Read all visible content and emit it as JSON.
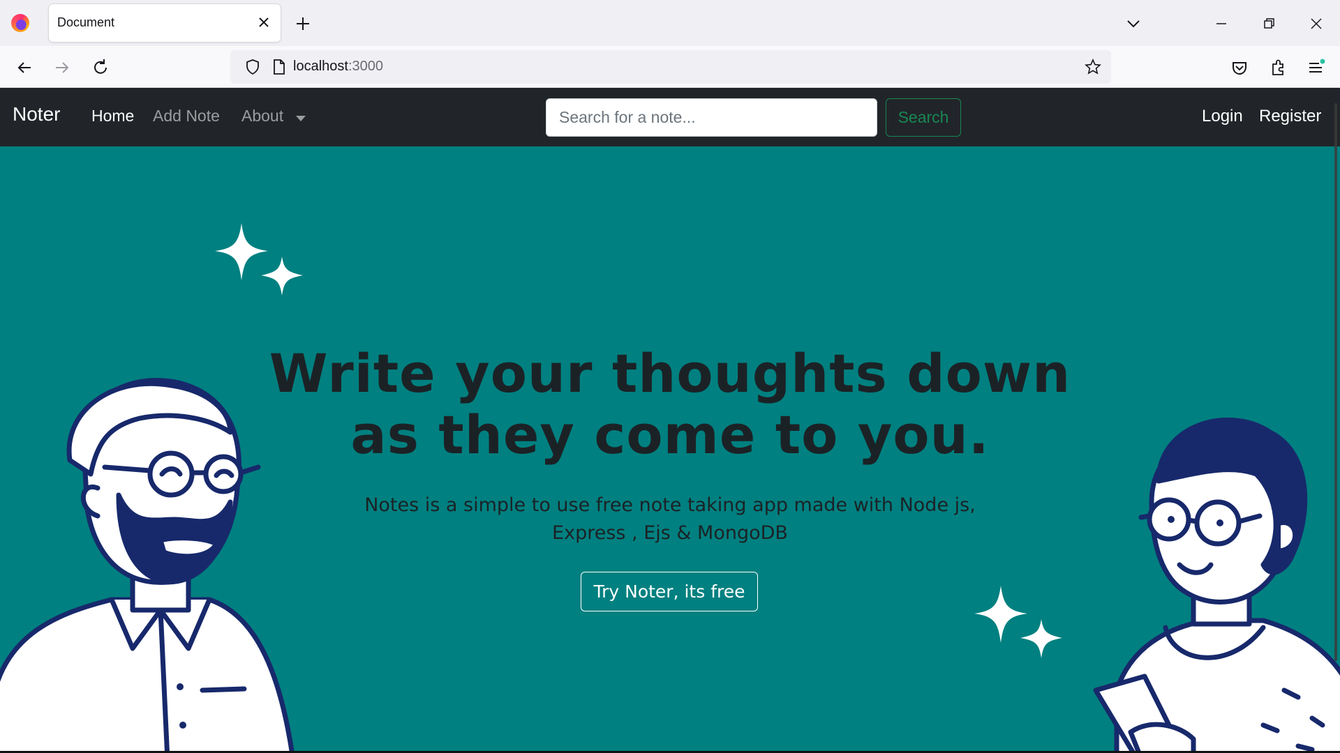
{
  "browser": {
    "tab_title": "Document",
    "url_host": "localhost",
    "url_port": ":3000"
  },
  "site": {
    "brand": "Noter",
    "nav": {
      "home": "Home",
      "add_note": "Add Note",
      "about": "About"
    },
    "search": {
      "placeholder": "Search for a note...",
      "button_label": "Search"
    },
    "auth": {
      "login": "Login",
      "register": "Register"
    }
  },
  "hero": {
    "title": "Write your thoughts down as they come to you.",
    "subtitle": "Notes is a simple to use free note taking app made with Node js, Express , Ejs & MongoDB",
    "cta_label": "Try Noter, its free"
  },
  "colors": {
    "navbar_bg": "#212529",
    "hero_bg": "#008080",
    "search_accent": "#198754",
    "illustration_navy": "#17296b"
  }
}
